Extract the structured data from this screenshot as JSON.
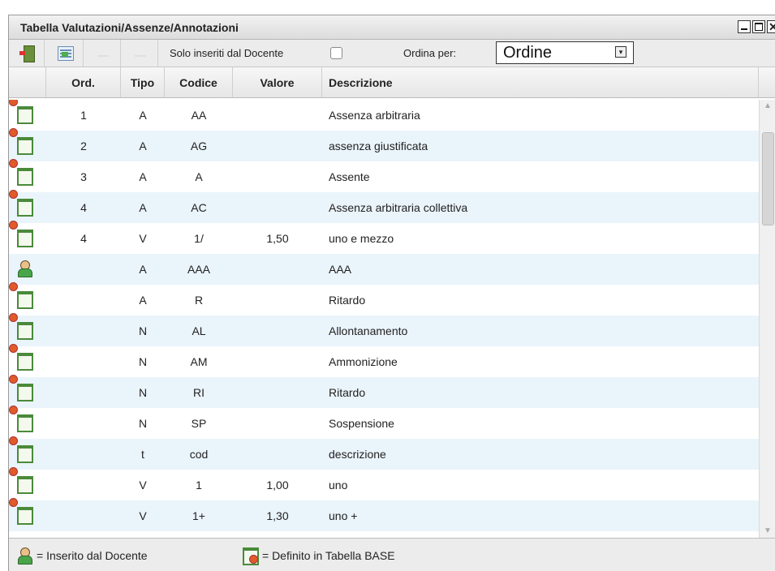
{
  "window": {
    "title": "Tabella Valutazioni/Assenze/Annotazioni",
    "close_glyph": "✕"
  },
  "toolbar": {
    "filter_label": "Solo inseriti dal Docente",
    "filter_checked": false,
    "order_label": "Ordina per:",
    "order_value": "Ordine",
    "order_arrow": "▾"
  },
  "columns": [
    "Ord.",
    "Tipo",
    "Codice",
    "Valore",
    "Descrizione"
  ],
  "rows": [
    {
      "icon": "base-table-icon",
      "ord": "1",
      "tipo": "A",
      "codice": "AA",
      "valore": "",
      "descrizione": "Assenza arbitraria"
    },
    {
      "icon": "base-table-icon",
      "ord": "2",
      "tipo": "A",
      "codice": "AG",
      "valore": "",
      "descrizione": "assenza giustificata"
    },
    {
      "icon": "base-table-icon",
      "ord": "3",
      "tipo": "A",
      "codice": "A",
      "valore": "",
      "descrizione": "Assente"
    },
    {
      "icon": "base-table-icon",
      "ord": "4",
      "tipo": "A",
      "codice": "AC",
      "valore": "",
      "descrizione": "Assenza arbitraria collettiva"
    },
    {
      "icon": "base-table-icon",
      "ord": "4",
      "tipo": "V",
      "codice": "1/",
      "valore": "1,50",
      "descrizione": "uno e mezzo"
    },
    {
      "icon": "teacher-icon",
      "ord": "",
      "tipo": "A",
      "codice": "AAA",
      "valore": "",
      "descrizione": "AAA"
    },
    {
      "icon": "base-table-icon",
      "ord": "",
      "tipo": "A",
      "codice": "R",
      "valore": "",
      "descrizione": "Ritardo"
    },
    {
      "icon": "base-table-icon",
      "ord": "",
      "tipo": "N",
      "codice": "AL",
      "valore": "",
      "descrizione": "Allontanamento"
    },
    {
      "icon": "base-table-icon",
      "ord": "",
      "tipo": "N",
      "codice": "AM",
      "valore": "",
      "descrizione": "Ammonizione"
    },
    {
      "icon": "base-table-icon",
      "ord": "",
      "tipo": "N",
      "codice": "RI",
      "valore": "",
      "descrizione": "Ritardo"
    },
    {
      "icon": "base-table-icon",
      "ord": "",
      "tipo": "N",
      "codice": "SP",
      "valore": "",
      "descrizione": "Sospensione"
    },
    {
      "icon": "base-table-icon",
      "ord": "",
      "tipo": "t",
      "codice": "cod",
      "valore": "",
      "descrizione": "descrizione"
    },
    {
      "icon": "base-table-icon",
      "ord": "",
      "tipo": "V",
      "codice": "1",
      "valore": "1,00",
      "descrizione": "uno"
    },
    {
      "icon": "base-table-icon",
      "ord": "",
      "tipo": "V",
      "codice": "1+",
      "valore": "1,30",
      "descrizione": "uno +"
    }
  ],
  "scrollbar": {
    "up": "▲",
    "down": "▼"
  },
  "legend": {
    "teacher": "= Inserito dal Docente",
    "base": "= Definito in Tabella BASE"
  }
}
